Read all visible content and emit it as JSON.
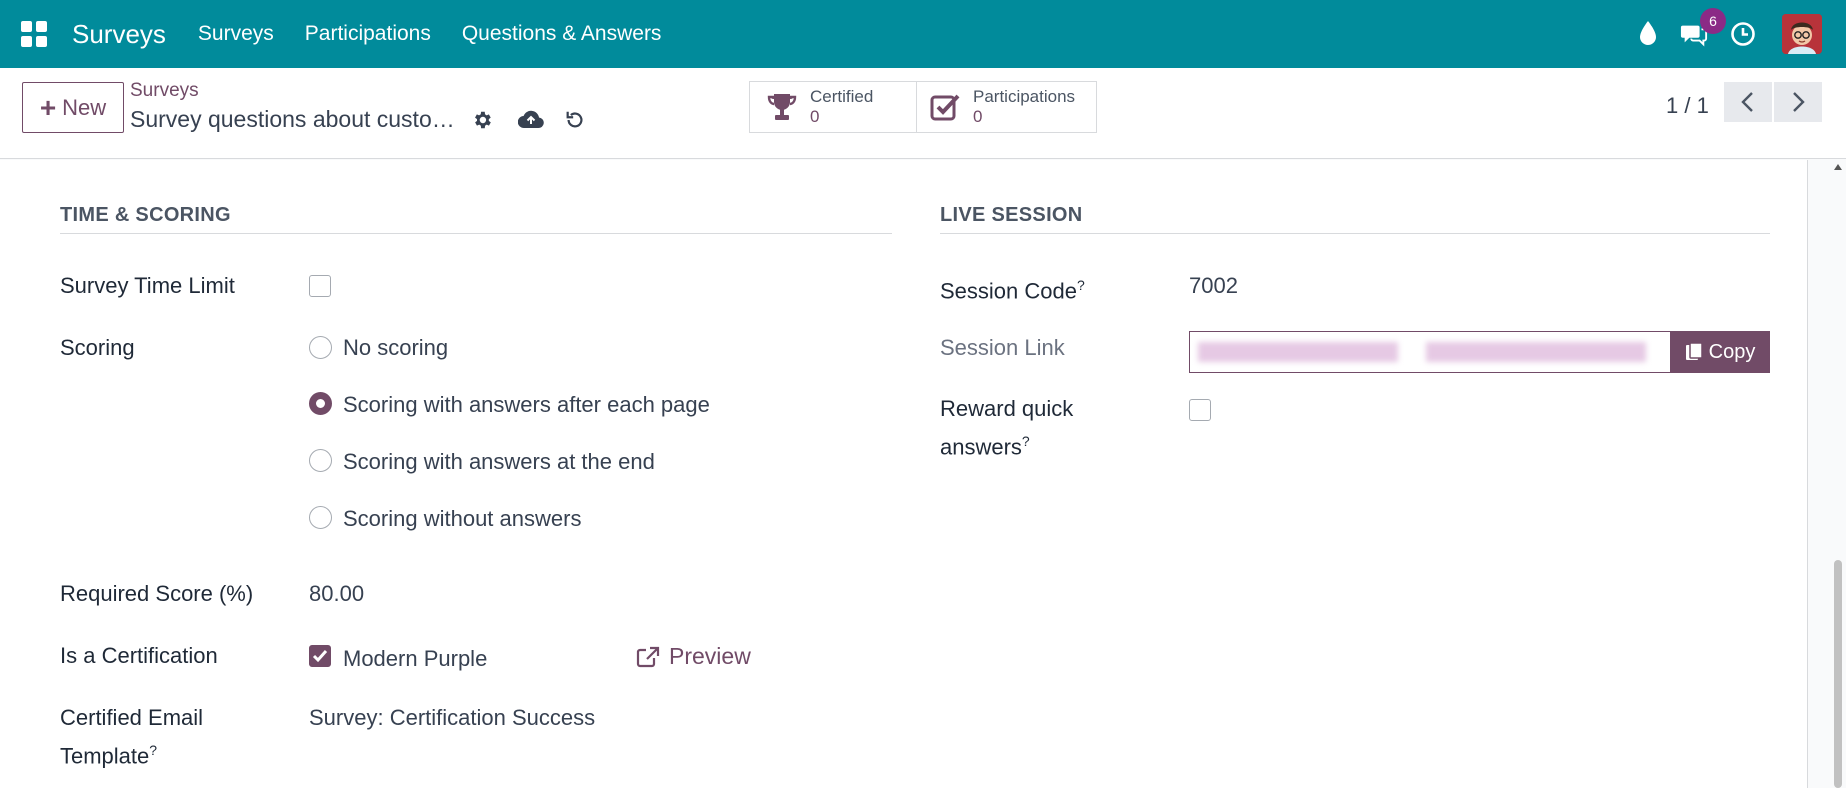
{
  "navbar": {
    "brand": "Surveys",
    "menu": [
      "Surveys",
      "Participations",
      "Questions & Answers"
    ],
    "chat_count": "6",
    "icons": [
      "water-drop-icon",
      "chat-icon",
      "clock-icon"
    ]
  },
  "control": {
    "new_label": "New",
    "breadcrumb": "Surveys",
    "record_title": "Survey questions about customer satisfaction",
    "stats": [
      {
        "label": "Certified",
        "value": "0"
      },
      {
        "label": "Participations",
        "value": "0"
      }
    ],
    "pager": "1 / 1"
  },
  "time_scoring": {
    "title": "TIME & SCORING",
    "time_limit_label": "Survey Time Limit",
    "time_limit_checked": false,
    "scoring_label": "Scoring",
    "scoring_options": [
      {
        "label": "No scoring",
        "selected": false
      },
      {
        "label": "Scoring with answers after each page",
        "selected": true
      },
      {
        "label": "Scoring with answers at the end",
        "selected": false
      },
      {
        "label": "Scoring without answers",
        "selected": false
      }
    ],
    "required_score_label": "Required Score (%)",
    "required_score_value": "80.00",
    "certification_label": "Is a Certification",
    "certification_checked": true,
    "certification_style": "Modern Purple",
    "preview_label": "Preview",
    "email_template_label_1": "Certified Email",
    "email_template_label_2": "Template",
    "email_template_value": "Survey: Certification Success"
  },
  "live_session": {
    "title": "LIVE SESSION",
    "session_code_label": "Session Code",
    "session_code_value": "7002",
    "session_link_label": "Session Link",
    "copy_label": "Copy",
    "reward_label_1": "Reward quick",
    "reward_label_2": "answers",
    "reward_checked": false
  },
  "colors": {
    "navbar": "#018b9b",
    "accent": "#714b67",
    "badge": "#8b2a86"
  }
}
